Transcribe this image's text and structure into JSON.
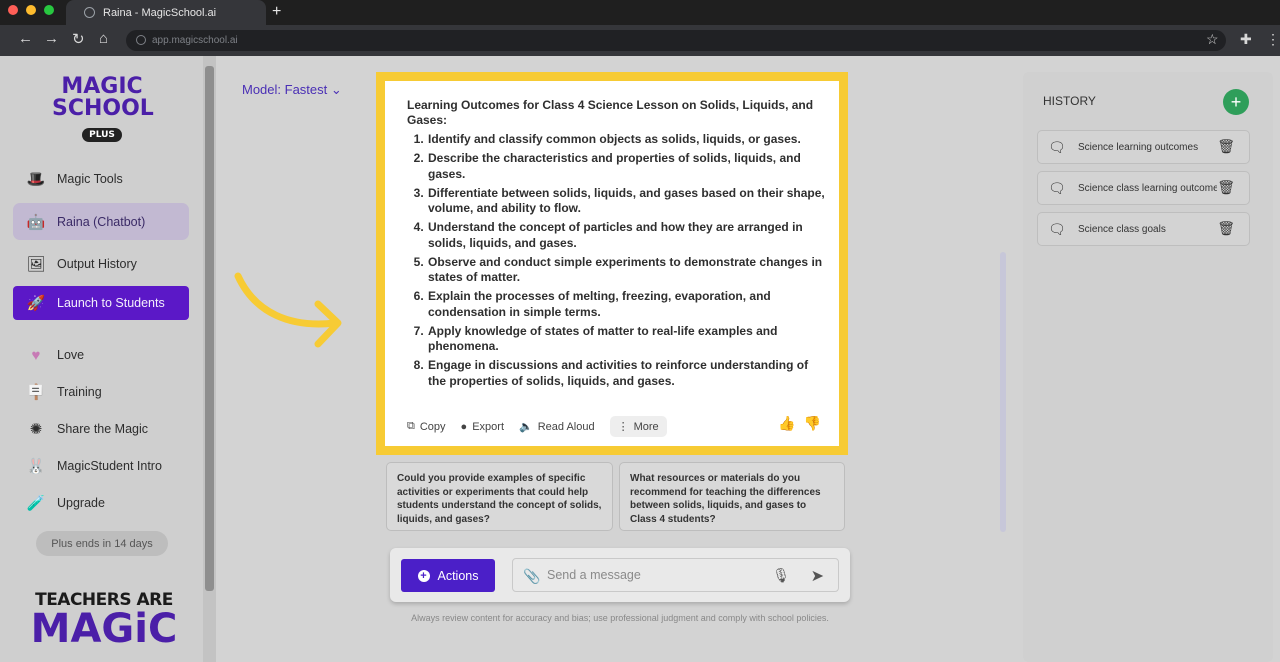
{
  "browser": {
    "tab_title": "Raina - MagicSchool.ai",
    "new_tab": "+",
    "url": "app.magicschool.ai"
  },
  "sidebar": {
    "logo_line1": "MAGIC",
    "logo_line2": "SCHOOL",
    "logo_badge": "PLUS",
    "items": [
      {
        "label": "Magic Tools",
        "icon": "magic-tools-icon"
      },
      {
        "label": "Raina (Chatbot)",
        "icon": "robot-icon"
      },
      {
        "label": "Output History",
        "icon": "history-icon"
      },
      {
        "label": "Launch to Students",
        "icon": "rocket-icon"
      },
      {
        "label": "Love",
        "icon": "heart-icon"
      },
      {
        "label": "Training",
        "icon": "easel-icon"
      },
      {
        "label": "Share the Magic",
        "icon": "sparkle-icon"
      },
      {
        "label": "MagicStudent Intro",
        "icon": "bunny-icon"
      },
      {
        "label": "Upgrade",
        "icon": "potion-icon"
      }
    ],
    "plus_status": "Plus ends in 14 days",
    "footer_line1": "TEACHERS ARE",
    "footer_line2": "MAGiC"
  },
  "model": {
    "label": "Model: Fastest"
  },
  "response": {
    "title": "Learning Outcomes for Class 4 Science Lesson on Solids, Liquids, and Gases:",
    "outcomes": [
      "Identify and classify common objects as solids, liquids, or gases.",
      "Describe the characteristics and properties of solids, liquids, and gases.",
      "Differentiate between solids, liquids, and gases based on their shape, volume, and ability to flow.",
      "Understand the concept of particles and how they are arranged in solids, liquids, and gases.",
      "Observe and conduct simple experiments to demonstrate changes in states of matter.",
      "Explain the processes of melting, freezing, evaporation, and condensation in simple terms.",
      "Apply knowledge of states of matter to real-life examples and phenomena.",
      "Engage in discussions and activities to reinforce understanding of the properties of solids, liquids, and gases."
    ],
    "actions": {
      "copy": "Copy",
      "export": "Export",
      "read_aloud": "Read Aloud",
      "more": "More"
    }
  },
  "suggestions": [
    "Could you provide examples of specific activities or experiments that could help students understand the concept of solids, liquids, and gases?",
    "What resources or materials do you recommend for teaching the differences between solids, liquids, and gases to Class 4 students?"
  ],
  "composer": {
    "actions_label": "Actions",
    "placeholder": "Send a message",
    "disclaimer": "Always review content for accuracy and bias; use professional judgment and comply with school policies."
  },
  "history": {
    "title": "HISTORY",
    "items": [
      "Science learning outcomes",
      "Science class learning outcomes",
      "Science class goals"
    ]
  },
  "colors": {
    "accent": "#5b18c7",
    "highlight": "#f7cb34",
    "add": "#2f9e5a"
  }
}
